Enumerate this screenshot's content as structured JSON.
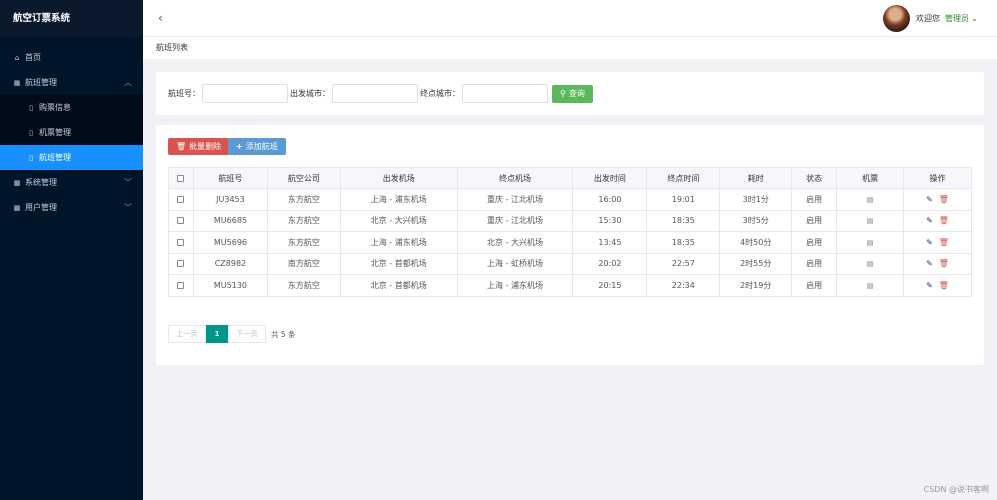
{
  "app": {
    "title": "航空订票系统"
  },
  "sidebar": {
    "items": [
      {
        "label": "首页",
        "icon": "home-icon"
      },
      {
        "label": "航班管理",
        "icon": "grid-icon",
        "expanded": true,
        "children": [
          {
            "label": "购票信息"
          },
          {
            "label": "机票管理"
          },
          {
            "label": "航班管理",
            "active": true
          }
        ]
      },
      {
        "label": "系统管理",
        "icon": "grid-icon"
      },
      {
        "label": "用户管理",
        "icon": "grid-icon"
      }
    ]
  },
  "header": {
    "back_icon": "chevron-left-icon",
    "welcome": "欢迎您",
    "user": "管理员"
  },
  "breadcrumb": "航班列表",
  "search": {
    "flight_no_label": "航班号：",
    "depart_city_label": "出发城市：",
    "arrive_city_label": "终点城市：",
    "flight_no_value": "",
    "depart_city_value": "",
    "arrive_city_value": "",
    "button": "查询"
  },
  "actions": {
    "batch_delete": "批量删除",
    "add": "添加航班"
  },
  "table": {
    "columns": [
      "航班号",
      "航空公司",
      "出发机场",
      "终点机场",
      "出发时间",
      "终点时间",
      "耗时",
      "状态",
      "机票",
      "操作"
    ],
    "rows": [
      [
        "JU3453",
        "东方航空",
        "上海 - 浦东机场",
        "重庆 - 江北机场",
        "16:00",
        "19:01",
        "3时1分",
        "启用"
      ],
      [
        "MU6685",
        "东方航空",
        "北京 - 大兴机场",
        "重庆 - 江北机场",
        "15:30",
        "18:35",
        "3时5分",
        "启用"
      ],
      [
        "MU5696",
        "东方航空",
        "上海 - 浦东机场",
        "北京 - 大兴机场",
        "13:45",
        "18:35",
        "4时50分",
        "启用"
      ],
      [
        "CZ8982",
        "南方航空",
        "北京 - 首都机场",
        "上海 - 虹桥机场",
        "20:02",
        "22:57",
        "2时55分",
        "启用"
      ],
      [
        "MU5130",
        "东方航空",
        "北京 - 首都机场",
        "上海 - 浦东机场",
        "20:15",
        "22:34",
        "2时19分",
        "启用"
      ]
    ]
  },
  "pagination": {
    "prev": "上一页",
    "current": "1",
    "next": "下一页",
    "total": "共 5 条"
  },
  "watermark": "CSDN @说书客啊",
  "colors": {
    "sidebar": "#001529",
    "active": "#1890ff",
    "search_btn": "#5cb85c",
    "delete_btn": "#d9534f",
    "add_btn": "#5b9bd5",
    "page_active": "#009688"
  }
}
